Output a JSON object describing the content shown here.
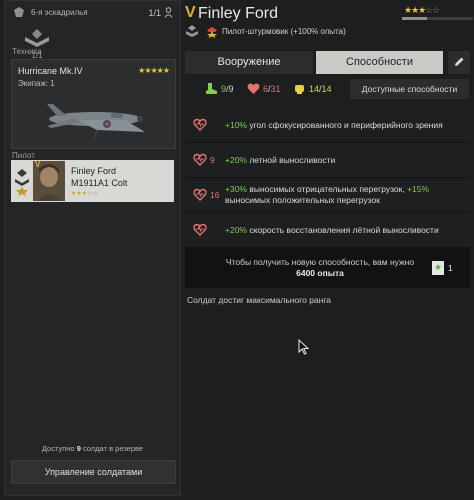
{
  "left_panel": {
    "squad_name": "6-я эскадрилья",
    "squad_count": "1/1",
    "squad_sub_count": "1/1",
    "tech_label": "Техника",
    "plane": {
      "name": "Hurricane Mk.IV",
      "crew": "Экипаж: 1",
      "stars": "★★★★★"
    },
    "pilot_label": "Пилот",
    "pilot": {
      "name": "Finley Ford",
      "weapon": "M1911A1 Colt",
      "stars_on": "★★★",
      "stars_off": "☆☆"
    },
    "reserve_prefix": "Доступно",
    "reserve_count": "9",
    "reserve_suffix": "солдат в резерве",
    "manage_button": "Управление солдатами"
  },
  "header": {
    "v_mark": "V",
    "name": "Finley Ford",
    "stars_on": "★★★",
    "stars_off": "☆☆",
    "xp_fraction": 0.35,
    "class_and_bonus": "Пилот-штурмовик  (+100% опыта)"
  },
  "tabs": {
    "weapons": "Вооружение",
    "abilities": "Способности"
  },
  "stats": [
    {
      "icon": "boot-icon",
      "value": "9",
      "max": "9",
      "color": "#7fce4c"
    },
    {
      "icon": "heart-icon",
      "value": "6",
      "max": "31",
      "color": "#e2736f"
    },
    {
      "icon": "fist-icon",
      "value": "14",
      "max": "14",
      "color": "#e6cf4a"
    }
  ],
  "available_abilities_button": "Доступные способности",
  "abilities": [
    {
      "num": "",
      "highlight": "+10%",
      "text": " угол сфокусированного и периферийного зрения"
    },
    {
      "num": "9",
      "highlight": "+20%",
      "text": " летной выносливости"
    },
    {
      "num": "16",
      "highlight": "+30%",
      "text": " выносимых отрицательных перегрузок, ",
      "highlight2": "+15%",
      "text2": " выносимых положительных перегрузок"
    },
    {
      "num": "",
      "highlight": "+20%",
      "text": " скорость восстановления лётной выносливости"
    }
  ],
  "new_ability": {
    "text": "Чтобы получить новую способность, вам нужно",
    "xp": "6400 опыта",
    "count": "1"
  },
  "max_rank": "Солдат достиг максимального ранга",
  "colors": {
    "accent_gold": "#e3b22a",
    "positive": "#7fce4c",
    "heart": "#e2736f"
  }
}
